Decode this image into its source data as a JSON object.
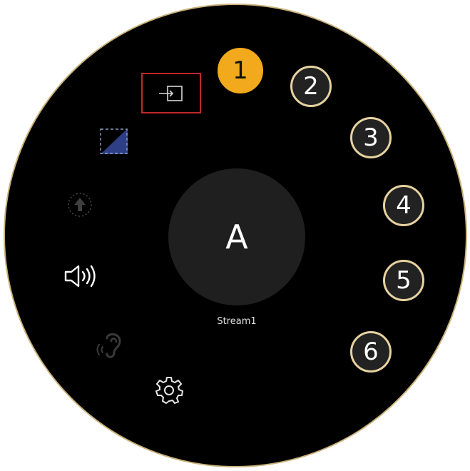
{
  "center": {
    "letter": "A",
    "stream_name": "Stream1"
  },
  "badges": [
    {
      "label": "1"
    },
    {
      "label": "2"
    },
    {
      "label": "3"
    },
    {
      "label": "4"
    },
    {
      "label": "5"
    },
    {
      "label": "6"
    }
  ],
  "icons": {
    "input": "input-icon",
    "aspect": "aspect-ratio-icon",
    "upload": "upload-icon",
    "volume": "volume-icon",
    "hearing": "hearing-icon",
    "settings": "gear-icon"
  },
  "colors": {
    "dial_border": "#c9b27a",
    "active_badge": "#f2a91c",
    "selection_box": "#c0272d",
    "aspect_fill": "#2f3f86"
  }
}
